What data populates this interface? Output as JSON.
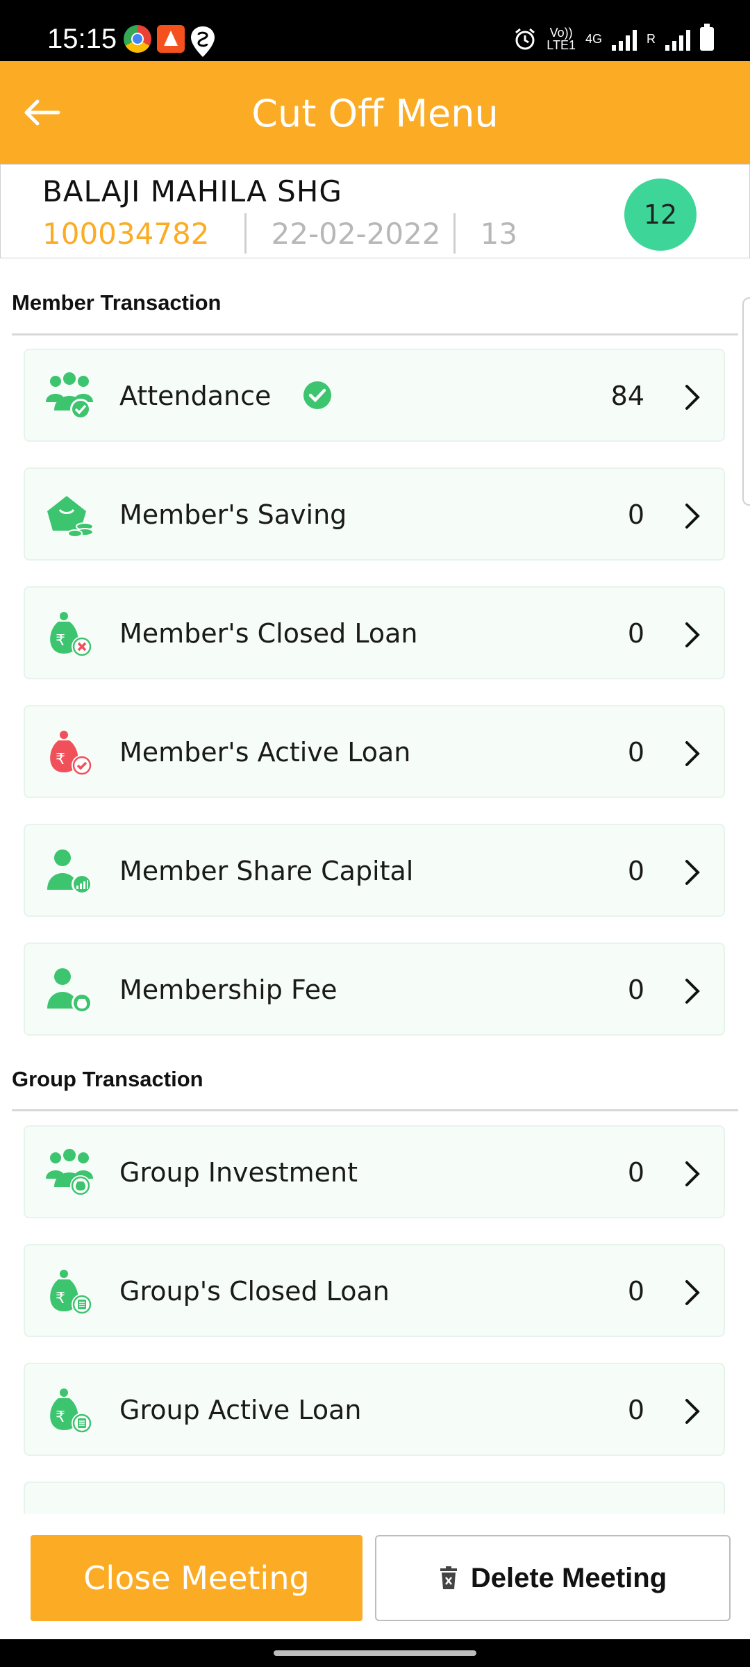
{
  "status_bar": {
    "time": "15:15",
    "volte_label": "Vo))\nLTE1",
    "network_label": "4G",
    "roaming_label": "R",
    "icons": [
      "chrome-icon",
      "app-flame-icon",
      "swiggy-icon",
      "alarm-icon",
      "signal-icon",
      "battery-icon"
    ]
  },
  "app_bar": {
    "title": "Cut Off Menu",
    "back_icon": "arrow-left-icon"
  },
  "group": {
    "name": "BALAJI MAHILA SHG",
    "code": "100034782",
    "date": "22-02-2022",
    "meeting_no": "13",
    "member_count": "12"
  },
  "member_section": {
    "title": "Member Transaction",
    "items": [
      {
        "label": "Attendance",
        "value": "84",
        "icon": "members-check-icon",
        "completed": true
      },
      {
        "label": "Member's Saving",
        "value": "0",
        "icon": "piggy-bank-icon"
      },
      {
        "label": "Member's Closed Loan",
        "value": "0",
        "icon": "money-bag-closed-icon"
      },
      {
        "label": "Member's Active Loan",
        "value": "0",
        "icon": "money-bag-active-icon"
      },
      {
        "label": "Member Share Capital",
        "value": "0",
        "icon": "member-share-icon"
      },
      {
        "label": "Membership Fee",
        "value": "0",
        "icon": "member-fee-icon"
      }
    ]
  },
  "group_section": {
    "title": "Group Transaction",
    "items": [
      {
        "label": "Group Investment",
        "value": "0",
        "icon": "group-investment-icon"
      },
      {
        "label": "Group's Closed Loan",
        "value": "0",
        "icon": "group-closed-loan-icon"
      },
      {
        "label": "Group Active Loan",
        "value": "0",
        "icon": "group-active-loan-icon"
      }
    ]
  },
  "actions": {
    "close_label": "Close Meeting",
    "delete_label": "Delete Meeting"
  },
  "colors": {
    "primary": "#fbab24",
    "accent_green": "#3ed698",
    "icon_green": "#3cc46e",
    "icon_red": "#f0505a"
  }
}
